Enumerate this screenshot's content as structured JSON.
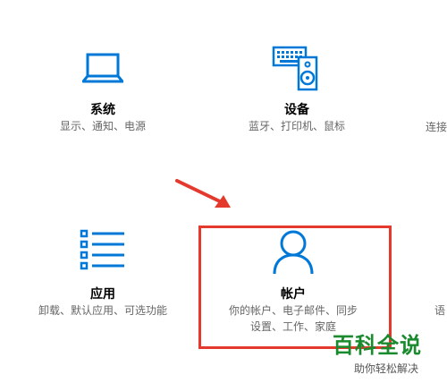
{
  "tiles": {
    "system": {
      "title": "系统",
      "desc": "显示、通知、电源",
      "icon": "laptop-icon"
    },
    "devices": {
      "title": "设备",
      "desc": "蓝牙、打印机、鼠标",
      "icon": "keyboard-speaker-icon"
    },
    "network_partial": {
      "desc": "连接"
    },
    "apps": {
      "title": "应用",
      "desc": "卸载、默认应用、可选功能",
      "icon": "list-icon"
    },
    "accounts": {
      "title": "帐户",
      "desc_line1": "你的帐户、电子邮件、同步",
      "desc_line2": "设置、工作、家庭",
      "icon": "person-icon"
    },
    "language_partial": {
      "desc": "语"
    }
  },
  "watermark": {
    "title": "百科全说",
    "subtitle": "助你轻松解决"
  },
  "colors": {
    "accent": "#0078d7",
    "highlight": "#e4392d",
    "watermark": "#1a8a2e"
  }
}
